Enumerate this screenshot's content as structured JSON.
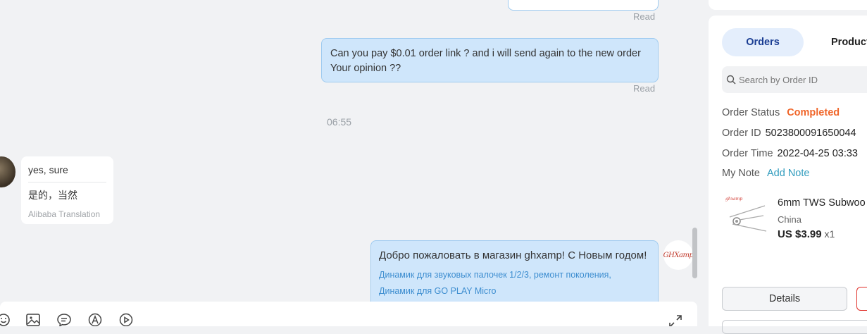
{
  "chat": {
    "messages": [
      {
        "id": "m1",
        "text_line1": "Can you pay $0.01 order link ? and i will send again to the new order",
        "text_line2": "Your opinion ??",
        "status": "Read"
      },
      {
        "id": "m0",
        "status": "Read"
      }
    ],
    "time_divider": "06:55",
    "incoming": {
      "original": "yes, sure",
      "translation": "是的，当然",
      "translation_source": "Alibaba Translation"
    },
    "outgoing_card": {
      "main": "Добро пожаловать в магазин ghxamp! С Новым годом!",
      "link_line1": "Динамик для звуковых палочек 1/2/3, ремонт поколения,",
      "link_line2": "Динамик для GO PLAY Micro",
      "avatar_text": "GHXamp"
    },
    "toolbar_icons": [
      "emoji-icon",
      "image-icon",
      "quick-reply-icon",
      "translate-icon",
      "video-icon",
      "expand-icon"
    ]
  },
  "panel": {
    "tabs": {
      "orders": "Orders",
      "products": "Products"
    },
    "search_placeholder": "Search by Order ID",
    "order_status_label": "Order Status",
    "order_status_value": "Completed",
    "order_id_label": "Order ID",
    "order_id_value": "5023800091650044",
    "order_time_label": "Order Time",
    "order_time_value": "2022-04-25 03:33",
    "note_label": "My Note",
    "add_note": "Add Note",
    "product": {
      "name": "6mm TWS Subwoo",
      "country": "China",
      "price": "US $3.99",
      "qty": "x1"
    },
    "details_button": "Details"
  },
  "colors": {
    "status_completed": "#f0662a",
    "link": "#2f9bbd",
    "bubble_out": "#cfe6fb",
    "tab_active": "#e4eefc"
  }
}
